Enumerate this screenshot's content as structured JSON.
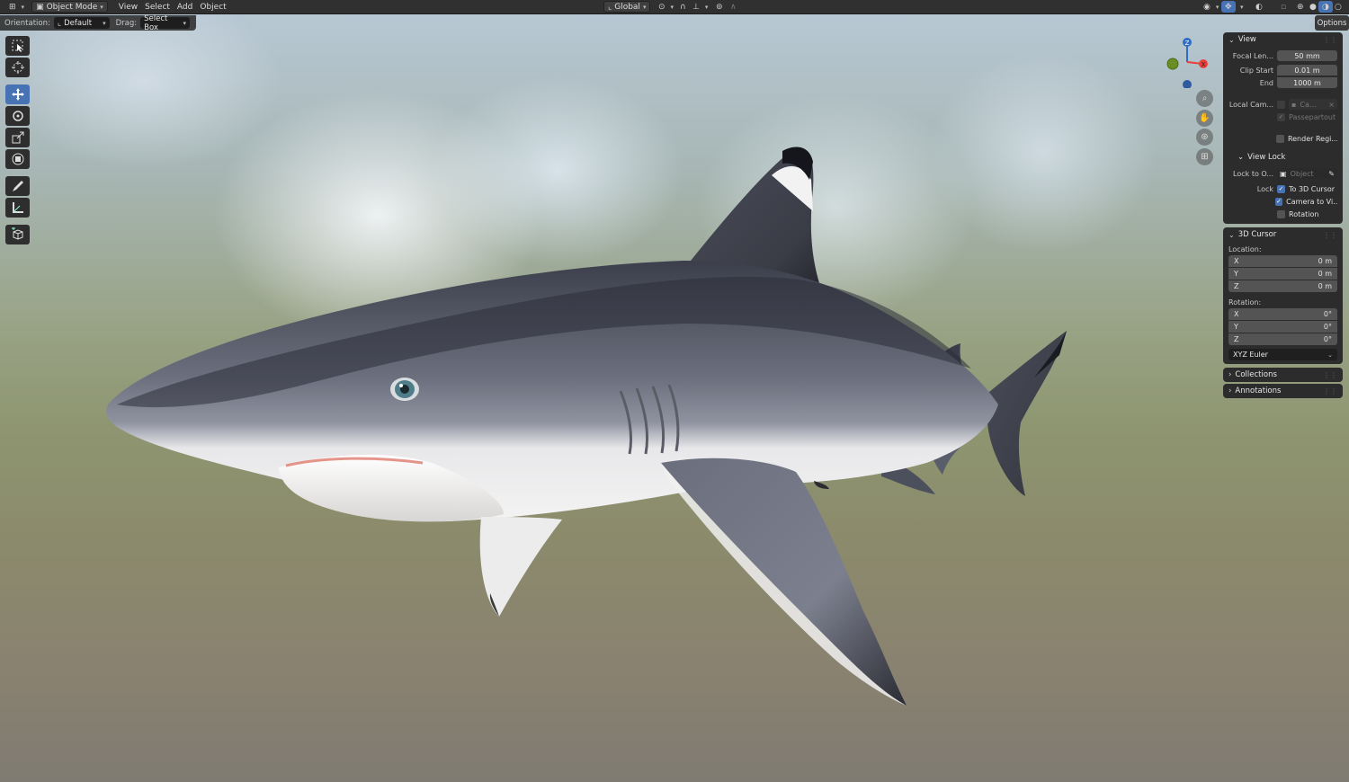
{
  "header": {
    "mode": "Object Mode",
    "menus": [
      "View",
      "Select",
      "Add",
      "Object"
    ],
    "transform_orientation": "Global"
  },
  "tool_settings": {
    "orientation_label": "Orientation:",
    "orientation_value": "Default",
    "drag_label": "Drag:",
    "drag_value": "Select Box",
    "options_label": "Options"
  },
  "toolbar": {
    "tools": [
      "select-box",
      "cursor",
      "move",
      "rotate",
      "scale",
      "transform",
      "annotate",
      "measure",
      "add-cube"
    ],
    "active": "move"
  },
  "gizmo": {
    "x": "X",
    "y": "Y",
    "z": "Z"
  },
  "colors": {
    "accent": "#4772b3",
    "axis_x": "#e8413c",
    "axis_y": "#6b8e23",
    "axis_z": "#2f6dc4"
  },
  "sidebar": {
    "view": {
      "title": "View",
      "focal_length_label": "Focal Len...",
      "focal_length": "50 mm",
      "clip_start_label": "Clip Start",
      "clip_start": "0.01 m",
      "clip_end_label": "End",
      "clip_end": "1000 m",
      "local_camera_label": "Local Cam...",
      "local_camera_value": "Ca...",
      "passepartout_label": "Passepartout",
      "render_region_label": "Render Regi..."
    },
    "view_lock": {
      "title": "View Lock",
      "lock_to_object_label": "Lock to O...",
      "lock_to_object_placeholder": "Object",
      "lock_label": "Lock",
      "to_3d_cursor": "To 3D Cursor",
      "camera_to_view": "Camera to Vi...",
      "rotation": "Rotation"
    },
    "cursor": {
      "title": "3D Cursor",
      "location_label": "Location:",
      "location": [
        {
          "axis": "X",
          "value": "0 m"
        },
        {
          "axis": "Y",
          "value": "0 m"
        },
        {
          "axis": "Z",
          "value": "0 m"
        }
      ],
      "rotation_label": "Rotation:",
      "rotation": [
        {
          "axis": "X",
          "value": "0°"
        },
        {
          "axis": "Y",
          "value": "0°"
        },
        {
          "axis": "Z",
          "value": "0°"
        }
      ],
      "rotation_mode": "XYZ Euler"
    },
    "collections": "Collections",
    "annotations": "Annotations"
  }
}
